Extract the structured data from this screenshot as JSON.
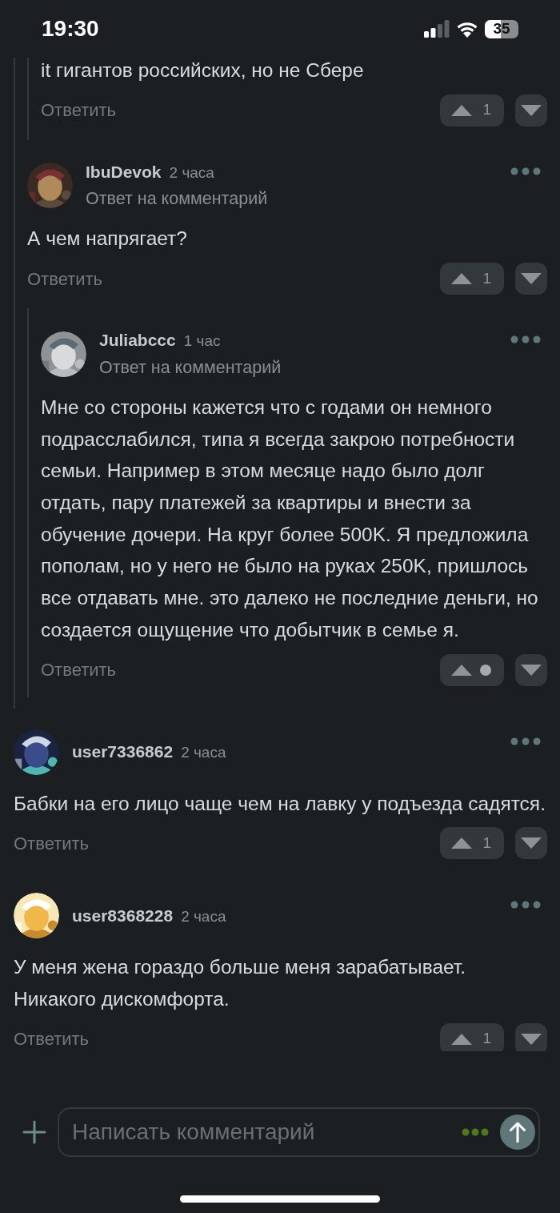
{
  "status_bar": {
    "time": "19:30",
    "battery": "35"
  },
  "comments": [
    {
      "kind": "thread",
      "children": [
        {
          "kind": "thread",
          "children": [
            {
              "kind": "tail",
              "body": "it гигантов российских, но не Сбере",
              "reply_label": "Ответить",
              "score": "1"
            }
          ]
        },
        {
          "kind": "comment",
          "author": "IbuDevok",
          "time": "2 часа",
          "reply_to": "Ответ на комментарий",
          "body": "А чем напрягает?",
          "reply_label": "Ответить",
          "score": "1",
          "children": [
            {
              "kind": "comment",
              "author": "Juliabccc",
              "time": "1 час",
              "reply_to": "Ответ на комментарий",
              "body": "Мне со стороны кажется что с годами он немного подрасслабился, типа я всегда закрою потребности семьи. Например в этом месяце надо было долг отдать, пару платежей за квартиры и внести за обучение дочери. На круг более 500K. Я предложила пополам, но у него не было на руках 250K, пришлось все отдавать мне. это далеко не последние деньги, но создается ощущение что добытчик в семье я.",
              "reply_label": "Ответить"
            }
          ]
        }
      ]
    },
    {
      "kind": "comment",
      "author": "user7336862",
      "time": "2 часа",
      "body": "Бабки на его лицо чаще чем на лавку у подъезда садятся.",
      "reply_label": "Ответить",
      "score": "1"
    },
    {
      "kind": "comment",
      "author": "user8368228",
      "time": "2 часа",
      "body": "У меня жена гораздо больше меня зарабатывает. Никакого дискомфорта.",
      "reply_label": "Ответить",
      "score": "1"
    }
  ],
  "composer": {
    "placeholder": "Написать комментарий"
  }
}
